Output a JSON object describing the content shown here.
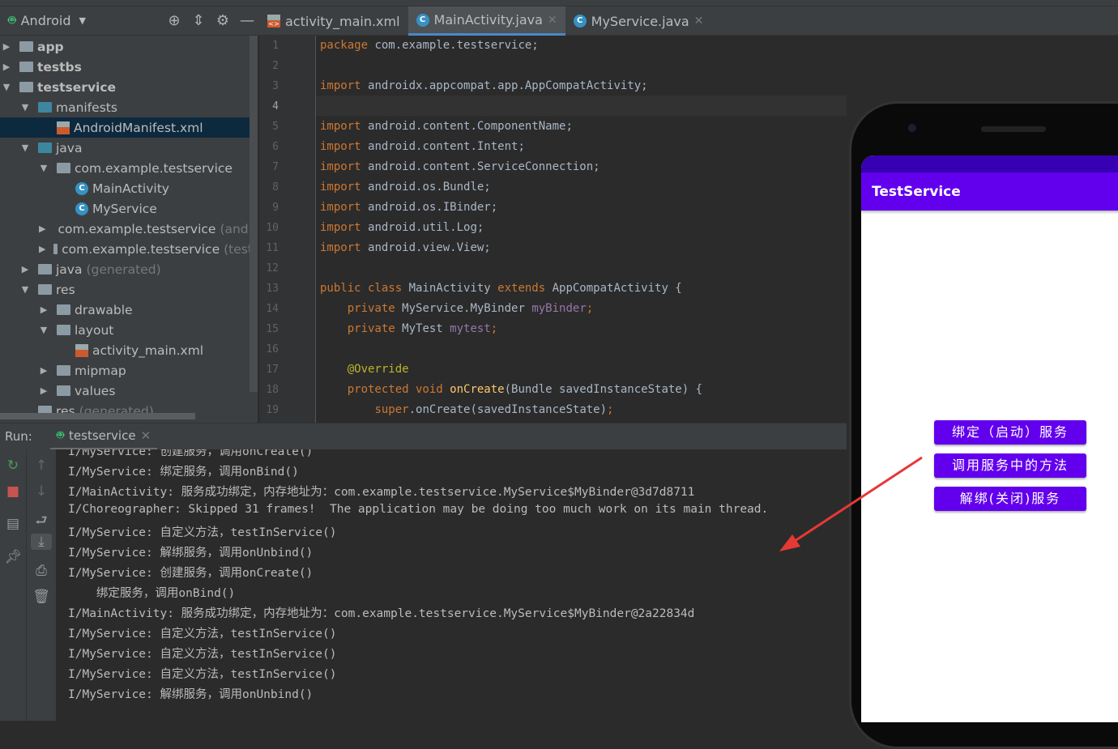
{
  "project_panel": {
    "view_mode": "Android",
    "tree": [
      {
        "label": "app",
        "depth": 0,
        "expanded": false,
        "bold": true,
        "icon": "module-folder-icon"
      },
      {
        "label": "testbs",
        "depth": 0,
        "expanded": false,
        "bold": true,
        "icon": "module-folder-icon"
      },
      {
        "label": "testservice",
        "depth": 0,
        "expanded": true,
        "bold": true,
        "icon": "module-folder-icon"
      },
      {
        "label": "manifests",
        "depth": 1,
        "expanded": true,
        "icon": "folder-icon"
      },
      {
        "label": "AndroidManifest.xml",
        "depth": 2,
        "icon": "manifest-file-icon",
        "selected": true
      },
      {
        "label": "java",
        "depth": 1,
        "expanded": true,
        "icon": "folder-icon"
      },
      {
        "label": "com.example.testservice",
        "depth": 2,
        "expanded": true,
        "icon": "package-icon"
      },
      {
        "label": "MainActivity",
        "depth": 3,
        "icon": "class-icon"
      },
      {
        "label": "MyService",
        "depth": 3,
        "icon": "class-icon"
      },
      {
        "label": "com.example.testservice",
        "suffix": "(androidTest)",
        "depth": 2,
        "expanded": false,
        "icon": "package-icon"
      },
      {
        "label": "com.example.testservice",
        "suffix": "(test)",
        "depth": 2,
        "expanded": false,
        "icon": "package-icon"
      },
      {
        "label": "java",
        "suffix": "(generated)",
        "depth": 1,
        "expanded": false,
        "icon": "generated-folder-icon"
      },
      {
        "label": "res",
        "depth": 1,
        "expanded": true,
        "icon": "res-folder-icon"
      },
      {
        "label": "drawable",
        "depth": 2,
        "expanded": false,
        "icon": "folder-icon"
      },
      {
        "label": "layout",
        "depth": 2,
        "expanded": true,
        "icon": "folder-icon"
      },
      {
        "label": "activity_main.xml",
        "depth": 3,
        "icon": "layout-file-icon"
      },
      {
        "label": "mipmap",
        "depth": 2,
        "expanded": false,
        "icon": "folder-icon"
      },
      {
        "label": "values",
        "depth": 2,
        "expanded": false,
        "icon": "folder-icon"
      },
      {
        "label": "res",
        "suffix": "(generated)",
        "depth": 1,
        "icon": "res-folder-icon"
      }
    ]
  },
  "editor": {
    "tabs": [
      {
        "label": "activity_main.xml",
        "icon": "xml-file-icon",
        "active": false,
        "closable": false
      },
      {
        "label": "MainActivity.java",
        "icon": "class-icon",
        "active": true,
        "closable": true
      },
      {
        "label": "MyService.java",
        "icon": "class-icon",
        "active": false,
        "closable": true
      }
    ],
    "current_line": 4,
    "lines": [
      [
        [
          "kw",
          "package "
        ],
        [
          "",
          "com.example.testservice;"
        ]
      ],
      [],
      [
        [
          "kw",
          "import "
        ],
        [
          "",
          "androidx.appcompat.app.AppCompatActivity;"
        ]
      ],
      [],
      [
        [
          "kw",
          "import "
        ],
        [
          "",
          "android.content.ComponentName;"
        ]
      ],
      [
        [
          "kw",
          "import "
        ],
        [
          "",
          "android.content.Intent;"
        ]
      ],
      [
        [
          "kw",
          "import "
        ],
        [
          "",
          "android.content.ServiceConnection;"
        ]
      ],
      [
        [
          "kw",
          "import "
        ],
        [
          "",
          "android.os.Bundle;"
        ]
      ],
      [
        [
          "kw",
          "import "
        ],
        [
          "",
          "android.os.IBinder;"
        ]
      ],
      [
        [
          "kw",
          "import "
        ],
        [
          "",
          "android.util.Log;"
        ]
      ],
      [
        [
          "kw",
          "import "
        ],
        [
          "",
          "android.view.View;"
        ]
      ],
      [],
      [
        [
          "kw",
          "public class "
        ],
        [
          "",
          "MainActivity "
        ],
        [
          "kw",
          "extends "
        ],
        [
          "",
          "AppCompatActivity {"
        ]
      ],
      [
        [
          "",
          "    "
        ],
        [
          "kw",
          "private "
        ],
        [
          "",
          "MyService.MyBinder "
        ],
        [
          "fd",
          "myBinder"
        ],
        [
          "kw",
          ";"
        ]
      ],
      [
        [
          "",
          "    "
        ],
        [
          "kw",
          "private "
        ],
        [
          "",
          "MyTest "
        ],
        [
          "fd",
          "mytest"
        ],
        [
          "kw",
          ";"
        ]
      ],
      [],
      [
        [
          "",
          "    "
        ],
        [
          "an",
          "@Override"
        ]
      ],
      [
        [
          "",
          "    "
        ],
        [
          "kw",
          "protected void "
        ],
        [
          "mt",
          "onCreate"
        ],
        [
          "",
          "(Bundle savedInstanceState) {"
        ]
      ],
      [
        [
          "",
          "        "
        ],
        [
          "kw",
          "super"
        ],
        [
          "",
          "."
        ],
        [
          "",
          "onCreate(savedInstanceState)"
        ],
        [
          "kw",
          ";"
        ]
      ]
    ]
  },
  "run_panel": {
    "label": "Run:",
    "tab": "testservice",
    "lines": [
      "I/MyService: 创建服务，调用onCreate()",
      "I/MyService: 绑定服务，调用onBind()",
      "I/MainActivity: 服务成功绑定，内存地址为：com.example.testservice.MyService$MyBinder@3d7d8711",
      "I/Choreographer: Skipped 31 frames!  The application may be doing too much work on its main thread.",
      "I/MyService: 自定义方法，testInService()",
      "I/MyService: 解绑服务，调用onUnbind()",
      "I/MyService: 创建服务，调用onCreate()",
      "    绑定服务，调用onBind()",
      "I/MainActivity: 服务成功绑定，内存地址为：com.example.testservice.MyService$MyBinder@2a22834d",
      "I/MyService: 自定义方法，testInService()",
      "I/MyService: 自定义方法，testInService()",
      "I/MyService: 自定义方法，testInService()",
      "I/MyService: 解绑服务，调用onUnbind()"
    ]
  },
  "emulator": {
    "app_title": "TestService",
    "buttons": [
      "绑定（启动）服务",
      "调用服务中的方法",
      "解绑(关闭)服务"
    ],
    "accent": "#6200ee",
    "status_color": "#3700b3"
  },
  "annotation": {
    "arrow_color": "#e53935"
  }
}
